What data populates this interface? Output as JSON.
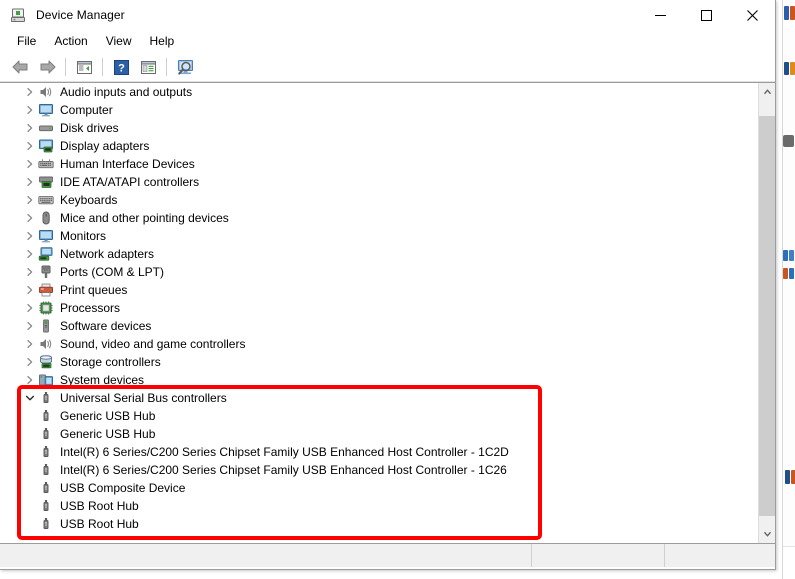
{
  "window": {
    "title": "Device Manager",
    "icon": "device-manager-icon",
    "controls": {
      "minimize": "Minimize",
      "maximize": "Maximize",
      "close": "Close"
    }
  },
  "menu": {
    "items": [
      {
        "label": "File"
      },
      {
        "label": "Action"
      },
      {
        "label": "View"
      },
      {
        "label": "Help"
      }
    ]
  },
  "toolbar": {
    "buttons": [
      {
        "name": "back-button",
        "icon": "back-arrow-icon",
        "label": "Back"
      },
      {
        "name": "forward-button",
        "icon": "forward-arrow-icon",
        "label": "Forward"
      },
      {
        "name": "show-hide-console-tree-button",
        "icon": "console-tree-icon",
        "label": "Show/Hide Console Tree"
      },
      {
        "name": "help-button",
        "icon": "help-question-icon",
        "label": "Help"
      },
      {
        "name": "properties-button",
        "icon": "properties-panel-icon",
        "label": "Properties"
      },
      {
        "name": "scan-hardware-changes-button",
        "icon": "scan-monitor-magnifier-icon",
        "label": "Scan for hardware changes"
      }
    ]
  },
  "tree": {
    "nodes": [
      {
        "label": "Audio inputs and outputs",
        "icon": "speaker-icon",
        "level": 0,
        "expanded": false,
        "chevron": "collapsed"
      },
      {
        "label": "Computer",
        "icon": "monitor-icon",
        "level": 0,
        "expanded": false,
        "chevron": "collapsed"
      },
      {
        "label": "Disk drives",
        "icon": "disk-drive-icon",
        "level": 0,
        "expanded": false,
        "chevron": "collapsed"
      },
      {
        "label": "Display adapters",
        "icon": "display-adapter-icon",
        "level": 0,
        "expanded": false,
        "chevron": "collapsed"
      },
      {
        "label": "Human Interface Devices",
        "icon": "hid-keyboard-icon",
        "level": 0,
        "expanded": false,
        "chevron": "collapsed"
      },
      {
        "label": "IDE ATA/ATAPI controllers",
        "icon": "ide-controller-icon",
        "level": 0,
        "expanded": false,
        "chevron": "collapsed"
      },
      {
        "label": "Keyboards",
        "icon": "keyboard-icon",
        "level": 0,
        "expanded": false,
        "chevron": "collapsed"
      },
      {
        "label": "Mice and other pointing devices",
        "icon": "mouse-icon",
        "level": 0,
        "expanded": false,
        "chevron": "collapsed"
      },
      {
        "label": "Monitors",
        "icon": "monitor-icon",
        "level": 0,
        "expanded": false,
        "chevron": "collapsed"
      },
      {
        "label": "Network adapters",
        "icon": "network-adapter-icon",
        "level": 0,
        "expanded": false,
        "chevron": "collapsed"
      },
      {
        "label": "Ports (COM & LPT)",
        "icon": "port-connector-icon",
        "level": 0,
        "expanded": false,
        "chevron": "collapsed"
      },
      {
        "label": "Print queues",
        "icon": "printer-icon",
        "level": 0,
        "expanded": false,
        "chevron": "collapsed"
      },
      {
        "label": "Processors",
        "icon": "processor-chip-icon",
        "level": 0,
        "expanded": false,
        "chevron": "collapsed"
      },
      {
        "label": "Software devices",
        "icon": "software-device-icon",
        "level": 0,
        "expanded": false,
        "chevron": "collapsed"
      },
      {
        "label": "Sound, video and game controllers",
        "icon": "speaker-icon",
        "level": 0,
        "expanded": false,
        "chevron": "collapsed"
      },
      {
        "label": "Storage controllers",
        "icon": "storage-controller-icon",
        "level": 0,
        "expanded": false,
        "chevron": "collapsed"
      },
      {
        "label": "System devices",
        "icon": "system-device-icon",
        "level": 0,
        "expanded": false,
        "chevron": "collapsed"
      },
      {
        "label": "Universal Serial Bus controllers",
        "icon": "usb-icon",
        "level": 0,
        "expanded": true,
        "chevron": "expanded"
      },
      {
        "label": "Generic USB Hub",
        "icon": "usb-icon",
        "level": 1,
        "expanded": false,
        "chevron": "none"
      },
      {
        "label": "Generic USB Hub",
        "icon": "usb-icon",
        "level": 1,
        "expanded": false,
        "chevron": "none"
      },
      {
        "label": "Intel(R) 6 Series/C200 Series Chipset Family USB Enhanced Host Controller - 1C2D",
        "icon": "usb-icon",
        "level": 1,
        "expanded": false,
        "chevron": "none"
      },
      {
        "label": "Intel(R) 6 Series/C200 Series Chipset Family USB Enhanced Host Controller - 1C26",
        "icon": "usb-icon",
        "level": 1,
        "expanded": false,
        "chevron": "none"
      },
      {
        "label": "USB Composite Device",
        "icon": "usb-icon",
        "level": 1,
        "expanded": false,
        "chevron": "none"
      },
      {
        "label": "USB Root Hub",
        "icon": "usb-icon",
        "level": 1,
        "expanded": false,
        "chevron": "none"
      },
      {
        "label": "USB Root Hub",
        "icon": "usb-icon",
        "level": 1,
        "expanded": false,
        "chevron": "none"
      }
    ]
  },
  "scrollbar": {
    "up_arrow": "scroll-up-icon",
    "down_arrow": "scroll-down-icon"
  },
  "annotation": {
    "color": "#ff0000",
    "target": "Universal Serial Bus controllers"
  },
  "status_bar": {
    "panes": [
      "",
      "",
      ""
    ]
  },
  "colors": {
    "accent_red": "#ff0000",
    "window_border": "#9c9c9c",
    "status_bg": "#f0f0f0",
    "scrollbar_thumb": "#cdcdcd"
  }
}
